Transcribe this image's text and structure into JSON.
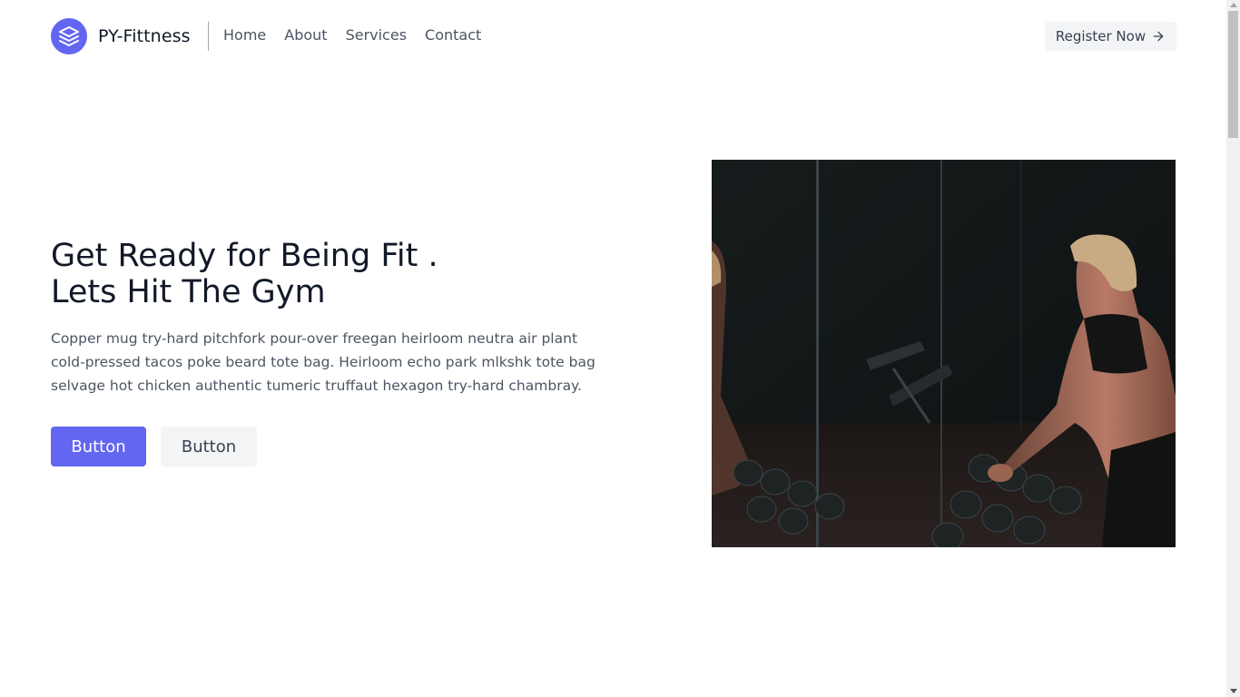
{
  "header": {
    "brand": "PY-Fittness",
    "logo_icon": "stack-layers-icon",
    "nav": [
      {
        "label": "Home"
      },
      {
        "label": "About"
      },
      {
        "label": "Services"
      },
      {
        "label": "Contact"
      }
    ],
    "register_label": "Register Now",
    "register_icon": "arrow-right-icon"
  },
  "hero": {
    "title_line1": "Get Ready for Being Fit .",
    "title_line2": "Lets Hit The Gym",
    "description": "Copper mug try-hard pitchfork pour-over freegan heirloom neutra air plant cold-pressed tacos poke beard tote bag. Heirloom echo park mlkshk tote bag selvage hot chicken authentic tumeric truffaut hexagon try-hard chambray.",
    "primary_button": "Button",
    "secondary_button": "Button",
    "image_description": "gym-woman-dumbbells-photo"
  },
  "colors": {
    "accent": "#6366f1",
    "text_dark": "#111827",
    "text_muted": "#4b5563",
    "button_gray": "#f3f4f6"
  }
}
